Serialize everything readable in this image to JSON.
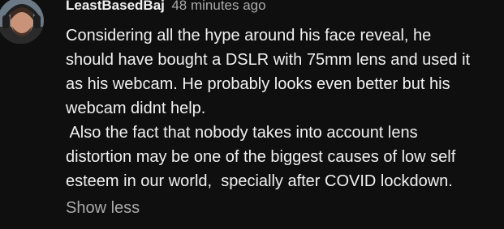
{
  "comment": {
    "author": "LeastBasedBaj",
    "timestamp": "48 minutes ago",
    "avatar_icon": "user-avatar",
    "lines": [
      "Considering all the hype around his face reveal, he",
      "should have bought a DSLR with 75mm lens and used it",
      "as his webcam. He probably looks even better but his",
      "webcam didnt help.",
      " Also the fact that nobody takes into account lens",
      "distortion may be one of the biggest causes of low self",
      "esteem in our world,  specially after COVID lockdown."
    ],
    "show_less_label": "Show less"
  },
  "colors": {
    "background": "#0f0f0f",
    "text_primary": "#f1f1f1",
    "text_secondary": "#aaaaaa"
  }
}
